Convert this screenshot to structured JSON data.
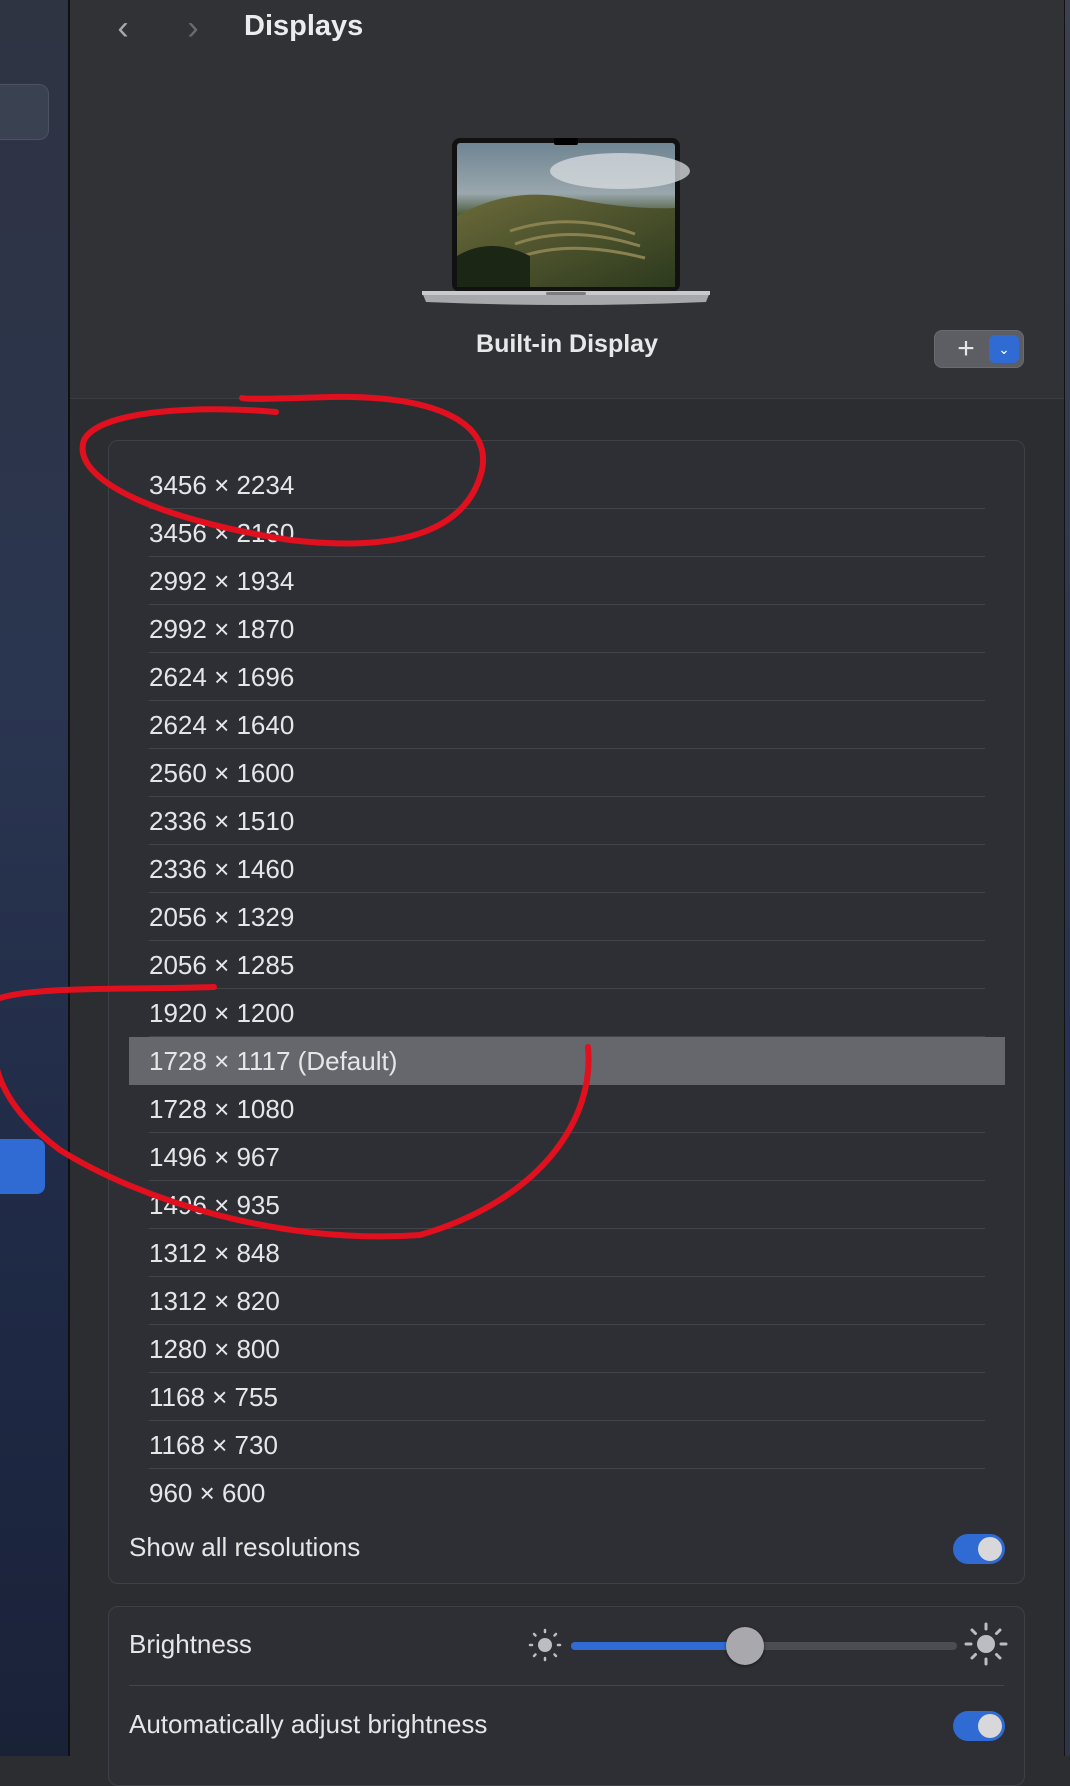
{
  "header": {
    "title": "Displays",
    "back_icon": "chevron-left-icon",
    "forward_icon": "chevron-right-icon"
  },
  "display": {
    "name": "Built-in Display",
    "add_label": "+",
    "menu_icon": "chevron-down-icon"
  },
  "resolutions": {
    "items": [
      {
        "label": "3456 × 2234"
      },
      {
        "label": "3456 × 2160"
      },
      {
        "label": "2992 × 1934"
      },
      {
        "label": "2992 × 1870"
      },
      {
        "label": "2624 × 1696"
      },
      {
        "label": "2624 × 1640"
      },
      {
        "label": "2560 × 1600"
      },
      {
        "label": "2336 × 1510"
      },
      {
        "label": "2336 × 1460"
      },
      {
        "label": "2056 × 1329"
      },
      {
        "label": "2056 × 1285"
      },
      {
        "label": "1920 × 1200"
      },
      {
        "label": "1728 × 1117 (Default)",
        "selected": true
      },
      {
        "label": "1728 × 1080"
      },
      {
        "label": "1496 × 967"
      },
      {
        "label": "1496 × 935"
      },
      {
        "label": "1312 × 848"
      },
      {
        "label": "1312 × 820"
      },
      {
        "label": "1280 × 800"
      },
      {
        "label": "1168 × 755"
      },
      {
        "label": "1168 × 730"
      },
      {
        "label": "960 × 600"
      }
    ],
    "show_all_label": "Show all resolutions",
    "show_all_on": true
  },
  "brightness": {
    "label": "Brightness",
    "level": 0.45,
    "auto_label": "Automatically adjust brightness",
    "auto_on": true
  },
  "colors": {
    "accent": "#2f6bd2",
    "annotation": "#e0101e"
  }
}
